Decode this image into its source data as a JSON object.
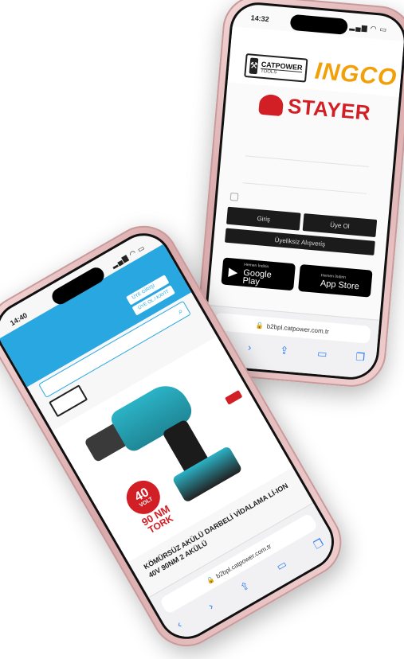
{
  "back_phone": {
    "status_time": "14:32",
    "logos": {
      "catpower_line1": "CATPOWER",
      "catpower_line2": "TOOLS",
      "ingco": "INGCO",
      "stayer": "STAYER"
    },
    "btn_left": "Giriş",
    "btn_right": "Üye Ol",
    "btn_wide": "Üyeliksiz Alışveriş",
    "store_google_small": "Hemen İndirin",
    "store_google": "Google Play",
    "store_apple_small": "Hemen İndirin",
    "store_apple": "App Store",
    "address": "b2bpl.catpower.com.tr"
  },
  "front_phone": {
    "status_time": "14:40",
    "header_btn_1": "ÜYE GİRİŞİ",
    "header_btn_2": "ÜYE OL / KAYIT",
    "volt_number": "40",
    "volt_unit": "VOLT",
    "torque_1": "90 NM",
    "torque_2": "TORK",
    "product_title": "KÖMÜRSÜZ AKÜLÜ DARBELİ VİDALAMA Lİ-ION 40V 90NM 2 AKÜLÜ",
    "address": "b2bpl.catpower.com.tr"
  }
}
